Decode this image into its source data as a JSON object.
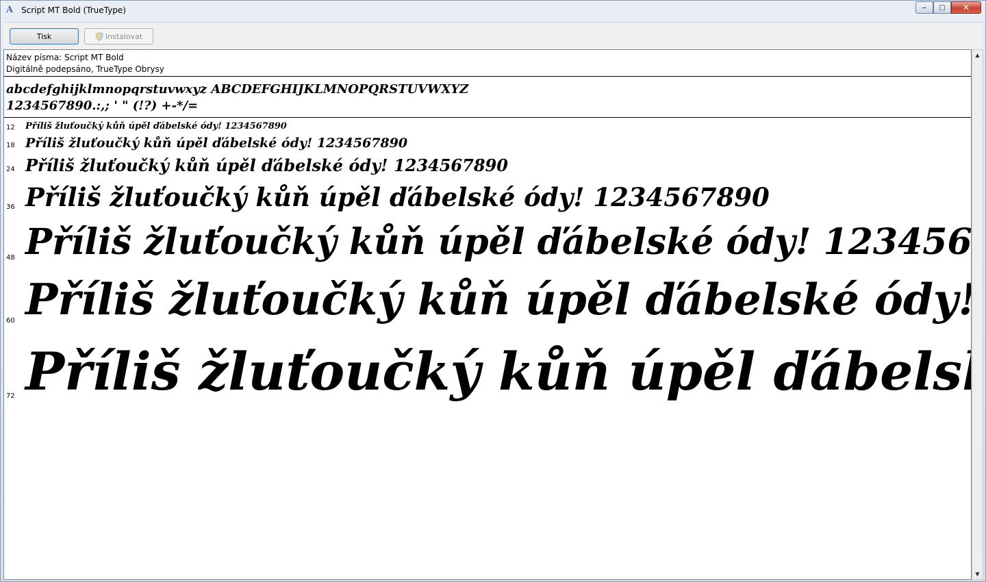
{
  "window": {
    "title": "Script MT Bold (TrueType)",
    "icon": "font-icon"
  },
  "toolbar": {
    "print_label": "Tisk",
    "install_label": "Instalovat"
  },
  "info": {
    "font_name_line": "Název písma: Script MT Bold",
    "signature_line": "Digitálně podepsáno, TrueType Obrysy"
  },
  "charset": {
    "line1": "abcdefghijklmnopqrstuvwxyz ABCDEFGHIJKLMNOPQRSTUVWXYZ",
    "line2": "1234567890.:,; ' \" (!?) +-*/="
  },
  "samples": {
    "text": "Příliš žluťoučký kůň úpěl ďábelské ódy! 1234567890",
    "sizes": [
      "12",
      "18",
      "24",
      "36",
      "48",
      "60",
      "72"
    ]
  }
}
